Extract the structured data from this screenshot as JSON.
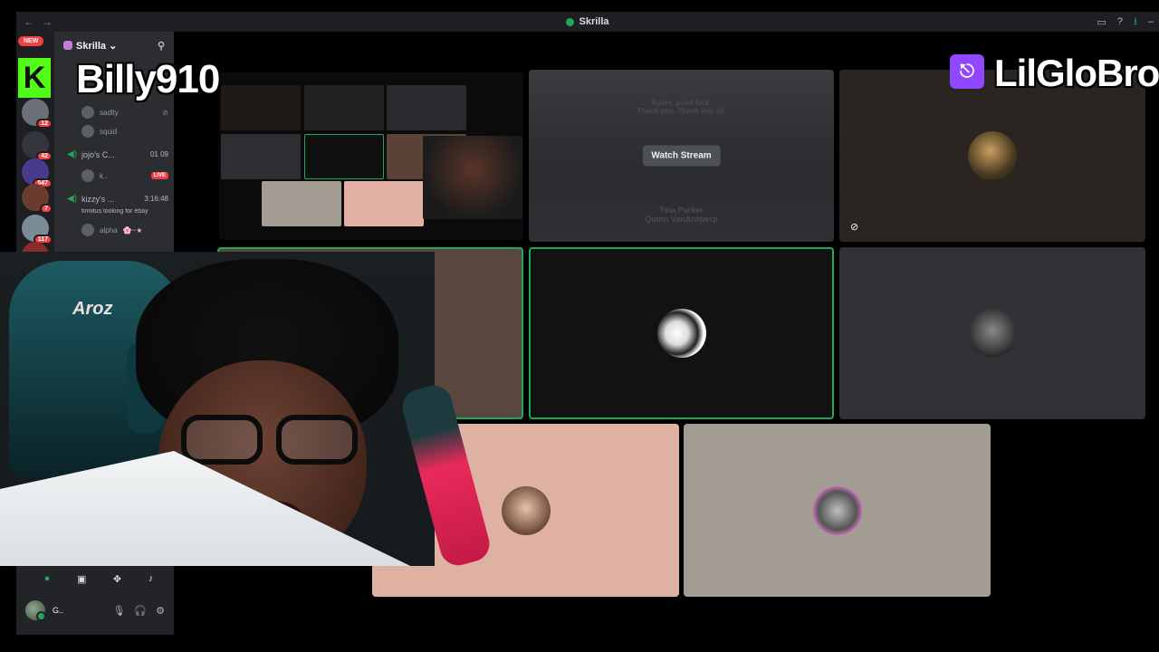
{
  "window": {
    "title": "Skrilla",
    "nav_back": "←",
    "nav_forward": "→",
    "controls": [
      "▭",
      "?",
      "⭳",
      "–"
    ]
  },
  "server_rail": {
    "new_label": "NEW",
    "servers": [
      {
        "badge": "44",
        "color": "#2a6b3a"
      },
      {
        "badge": "12",
        "color": "#6a6f78"
      },
      {
        "badge": "42",
        "color": "#33363c"
      },
      {
        "badge": "547",
        "color": "#4a3a8a"
      },
      {
        "badge": "7",
        "color": "#6b3b2c"
      },
      {
        "badge": "117",
        "color": "#7a8c95"
      },
      {
        "badge": "",
        "color": "#8a2a2a"
      }
    ]
  },
  "sidebar": {
    "server_name": "Skrilla ⌄",
    "users_top": [
      {
        "name": "sadlty"
      },
      {
        "name": "squid"
      }
    ],
    "voice_channels": [
      {
        "name": "jojo's C...",
        "time": "01  09",
        "user": "k..",
        "live": "LIVE"
      },
      {
        "name": "kizzy's ...",
        "time": "3:16:48",
        "status": "tinnitus looking for ebay",
        "user": "alpha",
        "user_status": "🌸~★"
      }
    ],
    "controls": {
      "camera": "●",
      "screen": "▣",
      "activities": "✥",
      "soundboard": "♪"
    },
    "user_panel": {
      "name": "G..",
      "mic": "🎙",
      "headphones": "🎧",
      "settings": "⚙"
    }
  },
  "stage": {
    "watch_stream_label": "Watch Stream",
    "ghost_text_top": "Again, good luck.\nThank you. Thank you all.",
    "ghost_text_bottom": "Tina Parker\nQuinn VanAntwerp"
  },
  "overlays": {
    "left_name": "Billy910",
    "left_logo": "K",
    "right_name": "LilGloBro",
    "twitch_glyph": "⎋"
  },
  "colors": {
    "discord_bg": "#2b2d31",
    "speaking": "#23a55a",
    "twitch": "#9146ff",
    "kick": "#53fc18"
  }
}
